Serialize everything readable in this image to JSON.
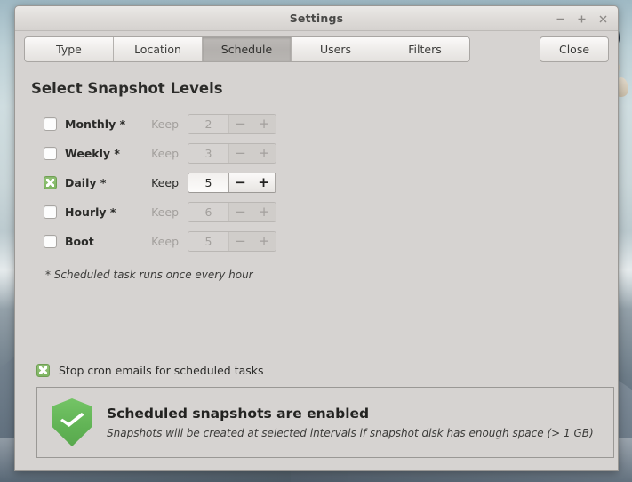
{
  "window": {
    "title": "Settings",
    "controls": [
      {
        "name": "minimize",
        "glyph": "minus"
      },
      {
        "name": "maximize",
        "glyph": "plus"
      },
      {
        "name": "close",
        "glyph": "cross"
      }
    ]
  },
  "tabs": [
    {
      "label": "Type",
      "active": false
    },
    {
      "label": "Location",
      "active": false
    },
    {
      "label": "Schedule",
      "active": true
    },
    {
      "label": "Users",
      "active": false
    },
    {
      "label": "Filters",
      "active": false
    }
  ],
  "close_button": {
    "label": "Close"
  },
  "main": {
    "section_title": "Select Snapshot Levels",
    "keep_label": "Keep",
    "minus_label": "−",
    "plus_label": "+",
    "levels": [
      {
        "name": "Monthly *",
        "checked": false,
        "keep": "2"
      },
      {
        "name": "Weekly *",
        "checked": false,
        "keep": "3"
      },
      {
        "name": "Daily *",
        "checked": true,
        "keep": "5"
      },
      {
        "name": "Hourly *",
        "checked": false,
        "keep": "6"
      },
      {
        "name": "Boot",
        "checked": false,
        "keep": "5"
      }
    ],
    "footnote": "* Scheduled task runs once every hour",
    "cron": {
      "label": "Stop cron emails for scheduled tasks",
      "checked": true
    },
    "status": {
      "title": "Scheduled snapshots are enabled",
      "subtitle": "Snapshots will be created at selected intervals if snapshot disk has enough space (> 1 GB)",
      "icon": "shield-check-icon",
      "accent_color": "#61b355"
    }
  },
  "colors": {
    "window_bg": "#d6d3d1",
    "checkbox_green": "#7fb562",
    "status_green": "#61b355",
    "text": "#2b2b29",
    "text_disabled": "#a3a09d"
  }
}
